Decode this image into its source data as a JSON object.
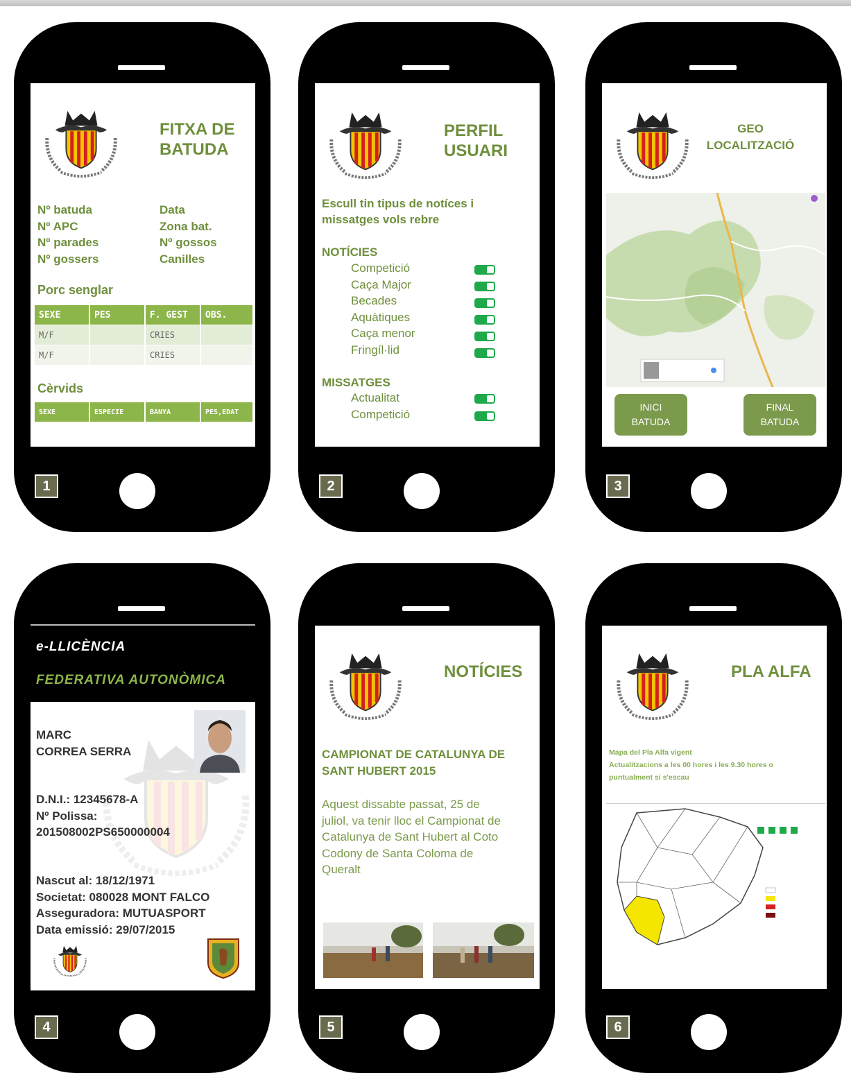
{
  "phones": [
    {
      "badge": "1",
      "title_line1": "FITXA DE",
      "title_line2": "BATUDA",
      "fields_left": [
        "Nº batuda",
        "Nº APC",
        "Nº parades",
        "Nº gossers"
      ],
      "fields_right": [
        "Data",
        "Zona bat.",
        "Nº gossos",
        "Canilles"
      ],
      "section1": "Porc senglar",
      "table1_headers": [
        "SEXE",
        "PES",
        "F. GEST",
        "OBS."
      ],
      "table1_rows": [
        [
          "M/F",
          "",
          "CRIES",
          ""
        ],
        [
          "M/F",
          "",
          "CRIES",
          ""
        ]
      ],
      "section2": "Cèrvids",
      "table2_headers": [
        "SEXE",
        "ESPECIE",
        "BANYA",
        "PES,EDAT"
      ]
    },
    {
      "badge": "2",
      "title_line1": "PERFIL",
      "title_line2": "USUARI",
      "intro_line1": "Escull tin tipus de notíces i",
      "intro_line2": "missatges vols rebre",
      "group1": "NOTÍCIES",
      "group1_items": [
        "Competició",
        "Caça Major",
        "Becades",
        "Aquàtiques",
        "Caça menor",
        "Fringíl·lid"
      ],
      "group2": "MISSATGES",
      "group2_items": [
        "Actualitat",
        "Competició"
      ]
    },
    {
      "badge": "3",
      "title_line1": "GEO",
      "title_line2": "LOCALITZACIÓ",
      "btn1_line1": "INICI",
      "btn1_line2": "BATUDA",
      "btn2_line1": "FINAL",
      "btn2_line2": "BATUDA"
    },
    {
      "badge": "4",
      "head1": "e-LLICÈNCIA",
      "head2": "FEDERATIVA AUTONÒMICA",
      "name1": "MARC",
      "name2": "CORREA SERRA",
      "dni": "D.N.I.: 12345678-A",
      "polissa_label": "Nº Polissa:",
      "polissa": "201508002PS650000004",
      "nascut": "Nascut al: 18/12/1971",
      "societat": "Societat: 080028 MONT FALCO",
      "asseguradora": "Asseguradora: MUTUASPORT",
      "emissio": "Data emissió: 29/07/2015"
    },
    {
      "badge": "5",
      "title": "NOTÍCIES",
      "headline1": "CAMPIONAT DE CATALUNYA DE",
      "headline2": "SANT HUBERT 2015",
      "body": [
        "Aquest dissabte passat, 25 de",
        "juliol, va tenir lloc el Campionat de",
        "Catalunya de Sant Hubert al Coto",
        "Codony de Santa Coloma de",
        "Queralt"
      ]
    },
    {
      "badge": "6",
      "title": "PLA ALFA",
      "line1": "Mapa del Pla Alfa vigent",
      "line2": "Actualitzacions a les 00 hores i les 9.30 hores o",
      "line3": "puntualment si s'escau"
    }
  ],
  "colors": {
    "accent": "#6e8f3c",
    "table_header": "#8db64a",
    "toggle": "#1fa94b",
    "button": "#7c9a4c"
  }
}
